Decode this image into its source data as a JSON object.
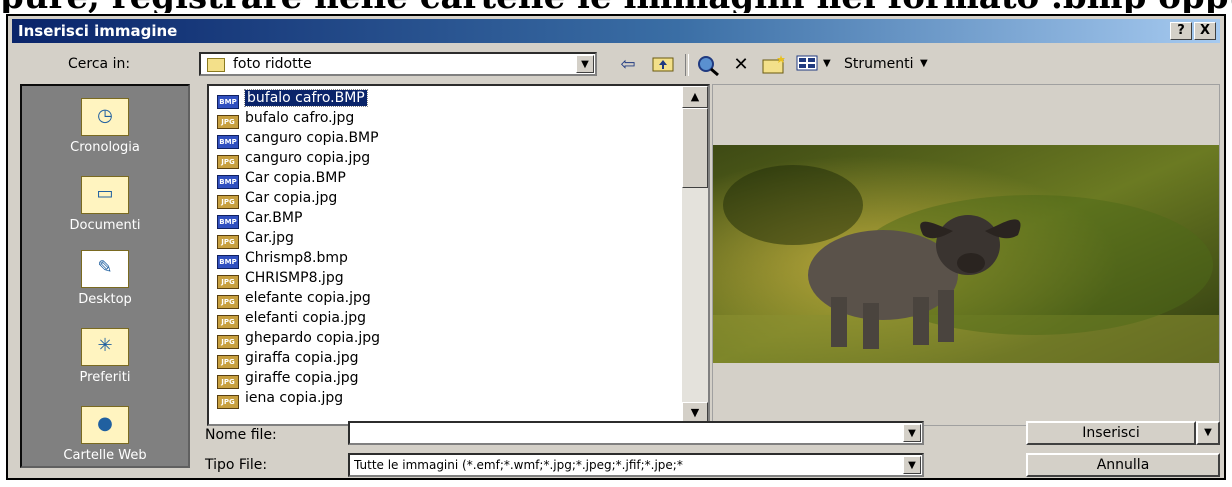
{
  "page": {
    "overflow_text": "pure, registrare nelle cartelle le immagini nel formato .bmp oppure .jpg."
  },
  "dialog": {
    "title": "Inserisci immagine",
    "help_button": "?",
    "close_button": "X"
  },
  "lookin": {
    "label": "Cerca in:",
    "value": "foto ridotte"
  },
  "toolbar": {
    "back_icon": "arrow-left-icon",
    "up_icon": "folder-up-icon",
    "search_icon": "search-web-icon",
    "delete_icon": "delete-icon",
    "newfolder_icon": "new-folder-icon",
    "views_icon": "views-icon",
    "tools_label": "Strumenti"
  },
  "places": [
    {
      "label": "Cronologia",
      "icon": "history-icon"
    },
    {
      "label": "Documenti",
      "icon": "documents-icon"
    },
    {
      "label": "Desktop",
      "icon": "desktop-icon"
    },
    {
      "label": "Preferiti",
      "icon": "favorites-icon"
    },
    {
      "label": "Cartelle Web",
      "icon": "web-folders-icon"
    }
  ],
  "files": [
    {
      "name": "bufalo cafro.BMP",
      "type": "BMP",
      "selected": true
    },
    {
      "name": "bufalo cafro.jpg",
      "type": "JPG"
    },
    {
      "name": "canguro copia.BMP",
      "type": "BMP"
    },
    {
      "name": "canguro copia.jpg",
      "type": "JPG"
    },
    {
      "name": "Car copia.BMP",
      "type": "BMP"
    },
    {
      "name": "Car copia.jpg",
      "type": "JPG"
    },
    {
      "name": "Car.BMP",
      "type": "BMP"
    },
    {
      "name": "Car.jpg",
      "type": "JPG"
    },
    {
      "name": "Chrismp8.bmp",
      "type": "BMP"
    },
    {
      "name": "CHRISMP8.jpg",
      "type": "JPG"
    },
    {
      "name": "elefante copia.jpg",
      "type": "JPG"
    },
    {
      "name": "elefanti copia.jpg",
      "type": "JPG"
    },
    {
      "name": "ghepardo copia.jpg",
      "type": "JPG"
    },
    {
      "name": "giraffa copia.jpg",
      "type": "JPG"
    },
    {
      "name": "giraffe copia.jpg",
      "type": "JPG"
    },
    {
      "name": "iena copia.jpg",
      "type": "JPG"
    }
  ],
  "filename": {
    "label": "Nome file:",
    "value": ""
  },
  "filetype": {
    "label": "Tipo File:",
    "value": "Tutte le immagini (*.emf;*.wmf;*.jpg;*.jpeg;*.jfif;*.jpe;*"
  },
  "buttons": {
    "insert": "Inserisci",
    "cancel": "Annulla"
  },
  "colors": {
    "selection": "#0a246a",
    "dialog_bg": "#d4d0c8",
    "places_bg": "#808080"
  }
}
